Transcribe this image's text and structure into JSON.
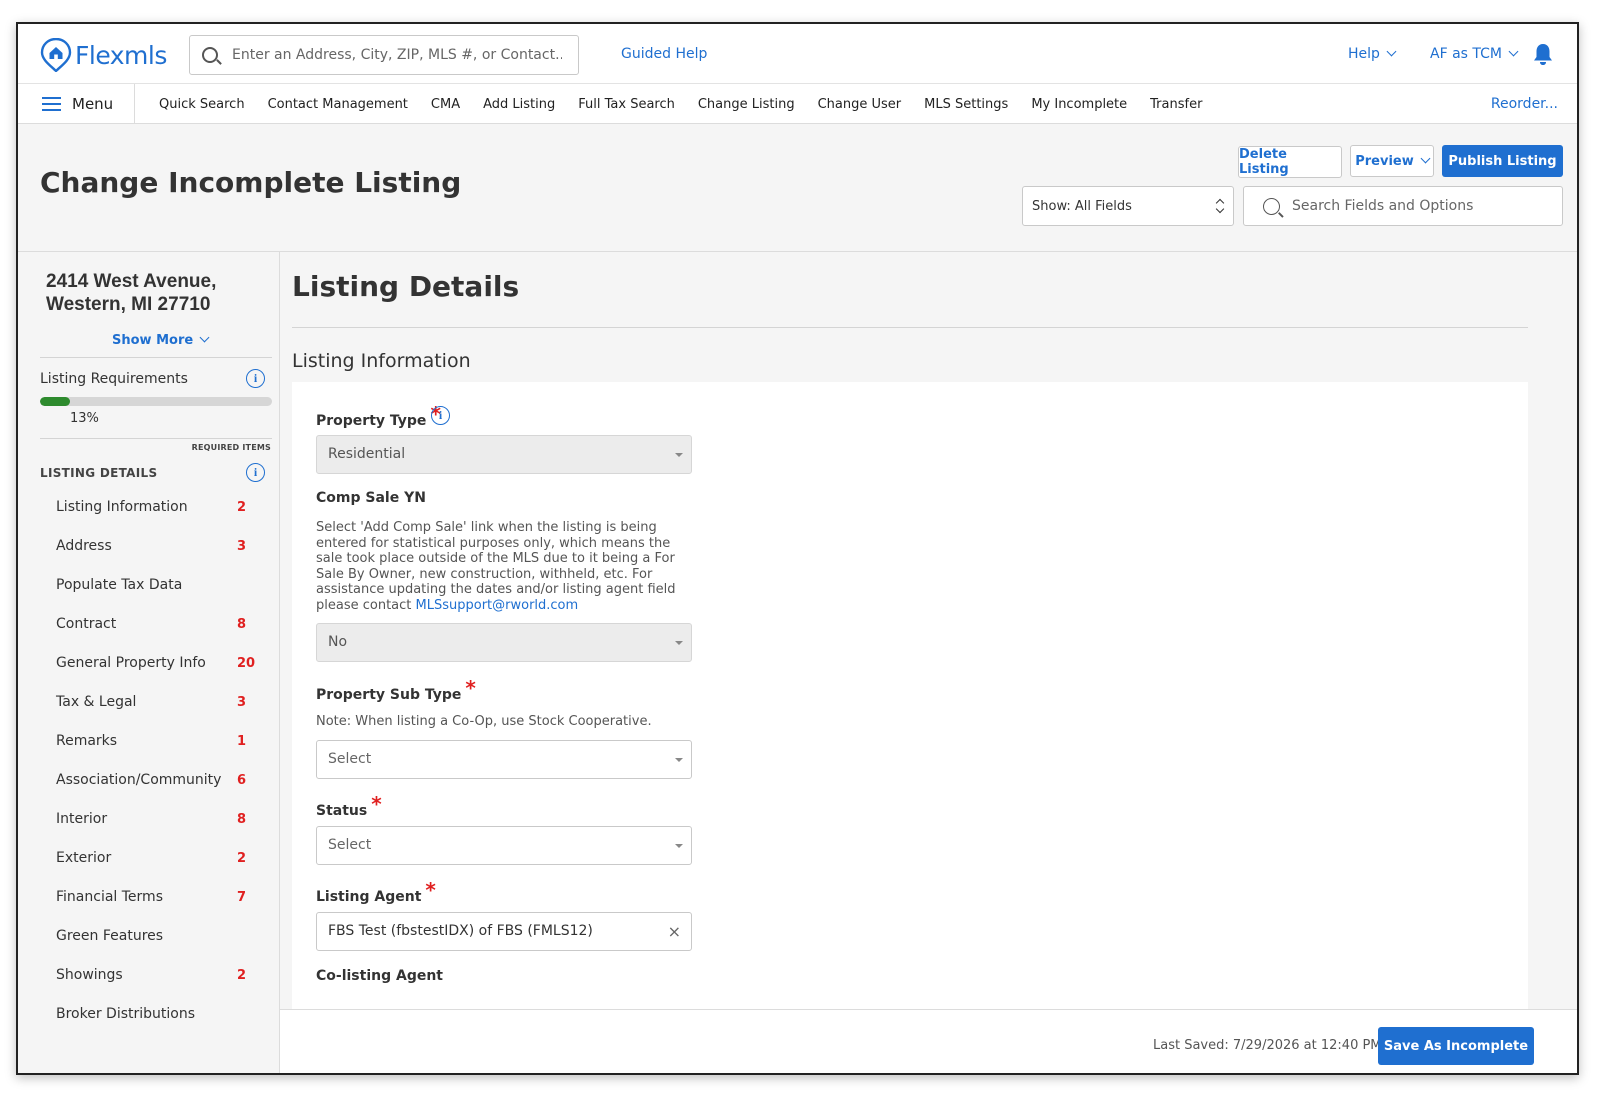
{
  "app": {
    "name": "Flexmls"
  },
  "header": {
    "search_placeholder": "Enter an Address, City, ZIP, MLS #, or Contact...",
    "guided_help": "Guided Help",
    "help": "Help",
    "user": "AF as TCM"
  },
  "nav": {
    "menu_label": "Menu",
    "items": [
      "Quick Search",
      "Contact Management",
      "CMA",
      "Add Listing",
      "Full Tax Search",
      "Change Listing",
      "Change User",
      "MLS Settings",
      "My Incomplete",
      "Transfer"
    ],
    "reorder": "Reorder..."
  },
  "page": {
    "title": "Change Incomplete Listing",
    "delete_btn": "Delete Listing",
    "preview_btn": "Preview",
    "publish_btn": "Publish Listing",
    "show_fields": "Show: All Fields",
    "field_search_placeholder": "Search Fields and Options"
  },
  "sidebar": {
    "address_line1": "2414 West Avenue,",
    "address_line2": "Western, MI 27710",
    "show_more": "Show More",
    "requirements_label": "Listing Requirements",
    "progress_percent": 13,
    "progress_text": "13%",
    "required_items": "REQUIRED ITEMS",
    "details_heading": "LISTING DETAILS",
    "items": [
      {
        "label": "Listing Information",
        "count": "2"
      },
      {
        "label": "Address",
        "count": "3"
      },
      {
        "label": "Populate Tax Data",
        "count": ""
      },
      {
        "label": "Contract",
        "count": "8"
      },
      {
        "label": "General Property Info",
        "count": "20"
      },
      {
        "label": "Tax & Legal",
        "count": "3"
      },
      {
        "label": "Remarks",
        "count": "1"
      },
      {
        "label": "Association/Community",
        "count": "6"
      },
      {
        "label": "Interior",
        "count": "8"
      },
      {
        "label": "Exterior",
        "count": "2"
      },
      {
        "label": "Financial Terms",
        "count": "7"
      },
      {
        "label": "Green Features",
        "count": ""
      },
      {
        "label": "Showings",
        "count": "2"
      },
      {
        "label": "Broker Distributions",
        "count": ""
      }
    ]
  },
  "main": {
    "title": "Listing Details",
    "section": "Listing Information",
    "fields": {
      "property_type": {
        "label": "Property Type",
        "value": "Residential"
      },
      "comp_sale": {
        "label": "Comp Sale YN",
        "note": "Select 'Add Comp Sale' link when the listing is being entered for statistical purposes only, which means the sale took place outside of the MLS due to it being a For Sale By Owner, new construction, withheld, etc. For assistance updating the dates and/or listing agent field please contact ",
        "email": "MLSsupport@rworld.com",
        "value": "No"
      },
      "property_sub_type": {
        "label": "Property Sub Type",
        "note": "Note: When listing a Co-Op, use Stock Cooperative.",
        "value": "Select"
      },
      "status": {
        "label": "Status",
        "value": "Select"
      },
      "listing_agent": {
        "label": "Listing Agent",
        "value": "FBS Test (fbstestIDX) of FBS (FMLS12)"
      },
      "co_listing_agent": {
        "label": "Co-listing Agent"
      }
    }
  },
  "footer": {
    "last_saved": "Last Saved: 7/29/2026 at 12:40 PM",
    "save_btn": "Save As Incomplete"
  },
  "colors": {
    "accent": "#1f6fd0",
    "required": "#e02020",
    "progress": "#2e8b2e"
  }
}
